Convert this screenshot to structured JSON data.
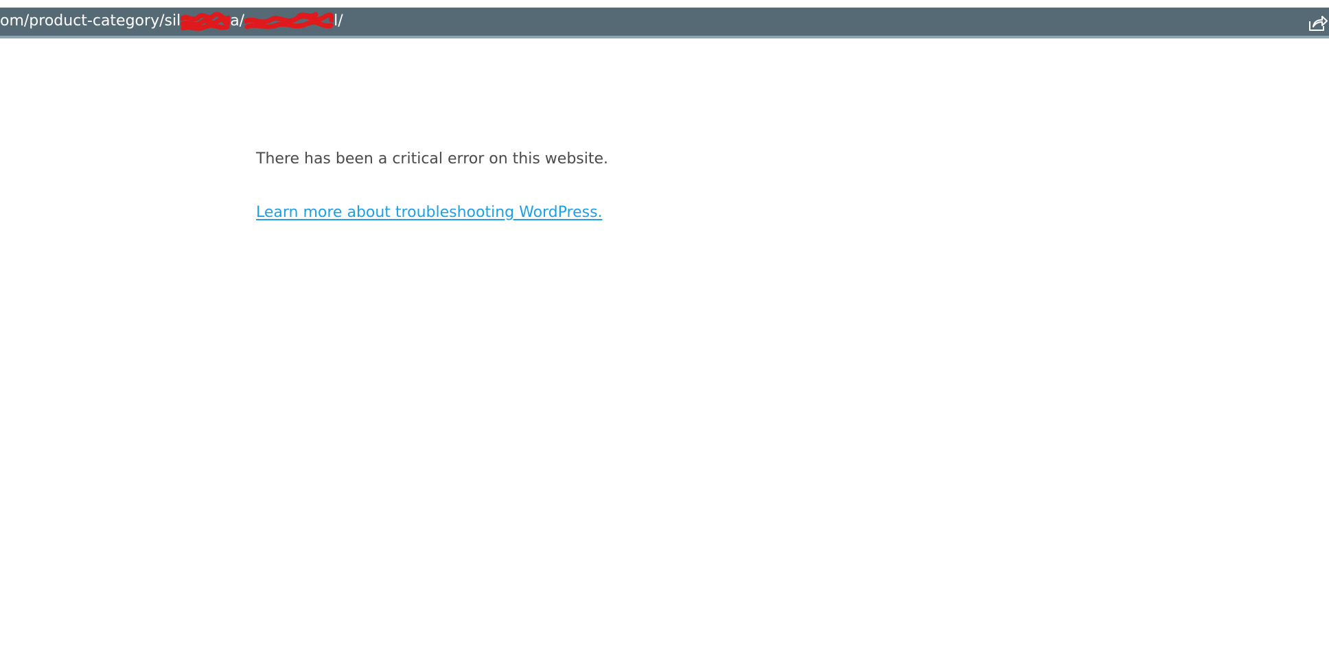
{
  "url_bar": {
    "url_prefix": "om/product-category/sil",
    "url_mid": "a/",
    "url_suffix": "l/",
    "redaction_color": "#e0191c",
    "share_icon": "share-arrow-icon"
  },
  "page": {
    "error_message": "There has been a critical error on this website.",
    "link_text": "Learn more about troubleshooting WordPress."
  },
  "colors": {
    "url_bar_bg": "#566a75",
    "text": "#4a4a4a",
    "link": "#1ea0e6"
  }
}
